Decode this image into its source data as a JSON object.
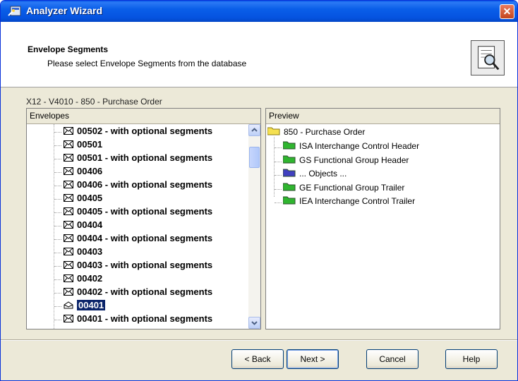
{
  "window": {
    "title": "Analyzer Wizard",
    "close_label": "✕"
  },
  "header": {
    "title": "Envelope Segments",
    "subtitle": "Please select Envelope Segments from the database"
  },
  "section_label": "X12 - V4010 - 850 - Purchase Order",
  "envelopes": {
    "header": "Envelopes",
    "items": [
      {
        "id": "00502",
        "suffix": " - with optional segments"
      },
      {
        "id": "00501",
        "suffix": ""
      },
      {
        "id": "00501",
        "suffix": " - with optional segments"
      },
      {
        "id": "00406",
        "suffix": ""
      },
      {
        "id": "00406",
        "suffix": " - with optional segments"
      },
      {
        "id": "00405",
        "suffix": ""
      },
      {
        "id": "00405",
        "suffix": " - with optional segments"
      },
      {
        "id": "00404",
        "suffix": ""
      },
      {
        "id": "00404",
        "suffix": " - with optional segments"
      },
      {
        "id": "00403",
        "suffix": ""
      },
      {
        "id": "00403",
        "suffix": " - with optional segments"
      },
      {
        "id": "00402",
        "suffix": ""
      },
      {
        "id": "00402",
        "suffix": " - with optional segments"
      },
      {
        "id": "00401",
        "suffix": "",
        "selected": true
      },
      {
        "id": "00401",
        "suffix": " - with optional segments"
      }
    ]
  },
  "preview": {
    "header": "Preview",
    "root": "850 - Purchase Order",
    "children": [
      {
        "label": "ISA  Interchange Control Header",
        "color": "#2fb52f"
      },
      {
        "label": "GS  Functional Group Header",
        "color": "#2fb52f"
      },
      {
        "label": "... Objects ...",
        "color": "#4040c0"
      },
      {
        "label": "GE  Functional Group Trailer",
        "color": "#2fb52f"
      },
      {
        "label": "IEA  Interchange Control Trailer",
        "color": "#2fb52f"
      }
    ]
  },
  "buttons": {
    "back": "< Back",
    "next": "Next >",
    "cancel": "Cancel",
    "help": "Help"
  },
  "colors": {
    "titlebar": "#0a58e8",
    "selection": "#0a246a",
    "folder_root": "#f5e050"
  }
}
